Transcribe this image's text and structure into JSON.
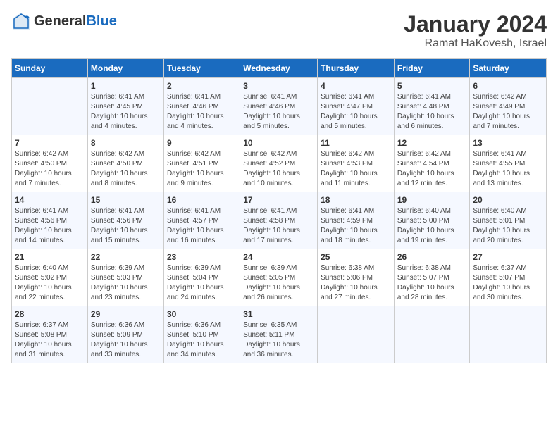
{
  "header": {
    "logo_general": "General",
    "logo_blue": "Blue",
    "month_title": "January 2024",
    "location": "Ramat HaKovesh, Israel"
  },
  "days_of_week": [
    "Sunday",
    "Monday",
    "Tuesday",
    "Wednesday",
    "Thursday",
    "Friday",
    "Saturday"
  ],
  "weeks": [
    [
      {
        "day": "",
        "info": ""
      },
      {
        "day": "1",
        "info": "Sunrise: 6:41 AM\nSunset: 4:45 PM\nDaylight: 10 hours\nand 4 minutes."
      },
      {
        "day": "2",
        "info": "Sunrise: 6:41 AM\nSunset: 4:46 PM\nDaylight: 10 hours\nand 4 minutes."
      },
      {
        "day": "3",
        "info": "Sunrise: 6:41 AM\nSunset: 4:46 PM\nDaylight: 10 hours\nand 5 minutes."
      },
      {
        "day": "4",
        "info": "Sunrise: 6:41 AM\nSunset: 4:47 PM\nDaylight: 10 hours\nand 5 minutes."
      },
      {
        "day": "5",
        "info": "Sunrise: 6:41 AM\nSunset: 4:48 PM\nDaylight: 10 hours\nand 6 minutes."
      },
      {
        "day": "6",
        "info": "Sunrise: 6:42 AM\nSunset: 4:49 PM\nDaylight: 10 hours\nand 7 minutes."
      }
    ],
    [
      {
        "day": "7",
        "info": "Sunrise: 6:42 AM\nSunset: 4:50 PM\nDaylight: 10 hours\nand 7 minutes."
      },
      {
        "day": "8",
        "info": "Sunrise: 6:42 AM\nSunset: 4:50 PM\nDaylight: 10 hours\nand 8 minutes."
      },
      {
        "day": "9",
        "info": "Sunrise: 6:42 AM\nSunset: 4:51 PM\nDaylight: 10 hours\nand 9 minutes."
      },
      {
        "day": "10",
        "info": "Sunrise: 6:42 AM\nSunset: 4:52 PM\nDaylight: 10 hours\nand 10 minutes."
      },
      {
        "day": "11",
        "info": "Sunrise: 6:42 AM\nSunset: 4:53 PM\nDaylight: 10 hours\nand 11 minutes."
      },
      {
        "day": "12",
        "info": "Sunrise: 6:42 AM\nSunset: 4:54 PM\nDaylight: 10 hours\nand 12 minutes."
      },
      {
        "day": "13",
        "info": "Sunrise: 6:41 AM\nSunset: 4:55 PM\nDaylight: 10 hours\nand 13 minutes."
      }
    ],
    [
      {
        "day": "14",
        "info": "Sunrise: 6:41 AM\nSunset: 4:56 PM\nDaylight: 10 hours\nand 14 minutes."
      },
      {
        "day": "15",
        "info": "Sunrise: 6:41 AM\nSunset: 4:56 PM\nDaylight: 10 hours\nand 15 minutes."
      },
      {
        "day": "16",
        "info": "Sunrise: 6:41 AM\nSunset: 4:57 PM\nDaylight: 10 hours\nand 16 minutes."
      },
      {
        "day": "17",
        "info": "Sunrise: 6:41 AM\nSunset: 4:58 PM\nDaylight: 10 hours\nand 17 minutes."
      },
      {
        "day": "18",
        "info": "Sunrise: 6:41 AM\nSunset: 4:59 PM\nDaylight: 10 hours\nand 18 minutes."
      },
      {
        "day": "19",
        "info": "Sunrise: 6:40 AM\nSunset: 5:00 PM\nDaylight: 10 hours\nand 19 minutes."
      },
      {
        "day": "20",
        "info": "Sunrise: 6:40 AM\nSunset: 5:01 PM\nDaylight: 10 hours\nand 20 minutes."
      }
    ],
    [
      {
        "day": "21",
        "info": "Sunrise: 6:40 AM\nSunset: 5:02 PM\nDaylight: 10 hours\nand 22 minutes."
      },
      {
        "day": "22",
        "info": "Sunrise: 6:39 AM\nSunset: 5:03 PM\nDaylight: 10 hours\nand 23 minutes."
      },
      {
        "day": "23",
        "info": "Sunrise: 6:39 AM\nSunset: 5:04 PM\nDaylight: 10 hours\nand 24 minutes."
      },
      {
        "day": "24",
        "info": "Sunrise: 6:39 AM\nSunset: 5:05 PM\nDaylight: 10 hours\nand 26 minutes."
      },
      {
        "day": "25",
        "info": "Sunrise: 6:38 AM\nSunset: 5:06 PM\nDaylight: 10 hours\nand 27 minutes."
      },
      {
        "day": "26",
        "info": "Sunrise: 6:38 AM\nSunset: 5:07 PM\nDaylight: 10 hours\nand 28 minutes."
      },
      {
        "day": "27",
        "info": "Sunrise: 6:37 AM\nSunset: 5:07 PM\nDaylight: 10 hours\nand 30 minutes."
      }
    ],
    [
      {
        "day": "28",
        "info": "Sunrise: 6:37 AM\nSunset: 5:08 PM\nDaylight: 10 hours\nand 31 minutes."
      },
      {
        "day": "29",
        "info": "Sunrise: 6:36 AM\nSunset: 5:09 PM\nDaylight: 10 hours\nand 33 minutes."
      },
      {
        "day": "30",
        "info": "Sunrise: 6:36 AM\nSunset: 5:10 PM\nDaylight: 10 hours\nand 34 minutes."
      },
      {
        "day": "31",
        "info": "Sunrise: 6:35 AM\nSunset: 5:11 PM\nDaylight: 10 hours\nand 36 minutes."
      },
      {
        "day": "",
        "info": ""
      },
      {
        "day": "",
        "info": ""
      },
      {
        "day": "",
        "info": ""
      }
    ]
  ]
}
